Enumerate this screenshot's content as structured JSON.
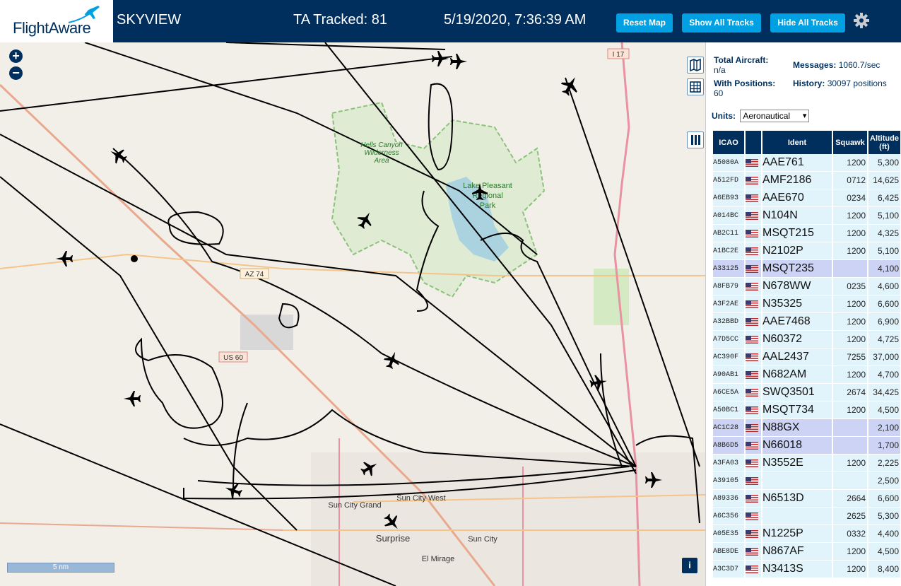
{
  "header": {
    "logo_text": "FlightAware",
    "title": "SKYVIEW",
    "tracked": "TA Tracked: 81",
    "datetime": "5/19/2020, 7:36:39 AM",
    "buttons": {
      "reset": "Reset Map",
      "show_all": "Show All Tracks",
      "hide_all": "Hide All Tracks"
    }
  },
  "map": {
    "zoom_in": "+",
    "zoom_out": "−",
    "scale_label": "5 nm",
    "info": "i",
    "labels": {
      "i17": "I 17",
      "az74": "AZ 74",
      "i60": "US 60",
      "hells_canyon": "Hells Canyon Wilderness Area",
      "lake_pleasant": "Lake Pleasant Regional Park",
      "sun_city_grand": "Sun City Grand",
      "sun_city_west": "Sun City West",
      "surprise": "Surprise",
      "sun_city": "Sun City",
      "el_mirage": "El Mirage"
    }
  },
  "stats": {
    "total_aircraft_label": "Total Aircraft:",
    "total_aircraft_value": "n/a",
    "with_positions_label": "With Positions:",
    "with_positions_value": "60",
    "messages_label": "Messages:",
    "messages_value": "1060.7/sec",
    "history_label": "History:",
    "history_value": "30097 positions",
    "units_label": "Units:",
    "units_value": "Aeronautical"
  },
  "table": {
    "headers": [
      "ICAO",
      "",
      "Ident",
      "Squawk",
      "Altitude (ft)"
    ],
    "rows": [
      {
        "icao": "A5080A",
        "ident": "AAE761",
        "squawk": "1200",
        "alt": "5,300",
        "sel": false
      },
      {
        "icao": "A512FD",
        "ident": "AMF2186",
        "squawk": "0712",
        "alt": "14,625",
        "sel": false
      },
      {
        "icao": "A6EB93",
        "ident": "AAE670",
        "squawk": "0234",
        "alt": "6,425",
        "sel": false
      },
      {
        "icao": "A014BC",
        "ident": "N104N",
        "squawk": "1200",
        "alt": "5,100",
        "sel": false
      },
      {
        "icao": "AB2C11",
        "ident": "MSQT215",
        "squawk": "1200",
        "alt": "4,325",
        "sel": false
      },
      {
        "icao": "A1BC2E",
        "ident": "N2102P",
        "squawk": "1200",
        "alt": "5,100",
        "sel": false
      },
      {
        "icao": "A33125",
        "ident": "MSQT235",
        "squawk": "",
        "alt": "4,100",
        "sel": true
      },
      {
        "icao": "A8FB79",
        "ident": "N678WW",
        "squawk": "0235",
        "alt": "4,600",
        "sel": false
      },
      {
        "icao": "A3F2AE",
        "ident": "N35325",
        "squawk": "1200",
        "alt": "6,600",
        "sel": false
      },
      {
        "icao": "A32BBD",
        "ident": "AAE7468",
        "squawk": "1200",
        "alt": "6,900",
        "sel": false
      },
      {
        "icao": "A7D5CC",
        "ident": "N60372",
        "squawk": "1200",
        "alt": "4,725",
        "sel": false
      },
      {
        "icao": "AC390F",
        "ident": "AAL2437",
        "squawk": "7255",
        "alt": "37,000",
        "sel": false
      },
      {
        "icao": "A90AB1",
        "ident": "N682AM",
        "squawk": "1200",
        "alt": "4,700",
        "sel": false
      },
      {
        "icao": "A6CE5A",
        "ident": "SWQ3501",
        "squawk": "2674",
        "alt": "34,425",
        "sel": false
      },
      {
        "icao": "A50BC1",
        "ident": "MSQT734",
        "squawk": "1200",
        "alt": "4,500",
        "sel": false
      },
      {
        "icao": "AC1C28",
        "ident": "N88GX",
        "squawk": "",
        "alt": "2,100",
        "sel": true
      },
      {
        "icao": "A8B6D5",
        "ident": "N66018",
        "squawk": "",
        "alt": "1,700",
        "sel": true
      },
      {
        "icao": "A3FA03",
        "ident": "N3552E",
        "squawk": "1200",
        "alt": "2,225",
        "sel": false
      },
      {
        "icao": "A39105",
        "ident": "",
        "squawk": "",
        "alt": "2,500",
        "sel": false
      },
      {
        "icao": "A89336",
        "ident": "N6513D",
        "squawk": "2664",
        "alt": "6,600",
        "sel": false
      },
      {
        "icao": "A6C356",
        "ident": "",
        "squawk": "2625",
        "alt": "5,300",
        "sel": false
      },
      {
        "icao": "A05E35",
        "ident": "N1225P",
        "squawk": "0332",
        "alt": "4,400",
        "sel": false
      },
      {
        "icao": "ABE8DE",
        "ident": "N867AF",
        "squawk": "1200",
        "alt": "4,500",
        "sel": false
      },
      {
        "icao": "A3C3D7",
        "ident": "N3413S",
        "squawk": "1200",
        "alt": "8,400",
        "sel": false
      }
    ]
  },
  "colors": {
    "header_bg": "#002f5d",
    "button_bg": "#00a0e2",
    "row_bg": "#e1f3fb",
    "row_selected": "#cdd3f5"
  }
}
